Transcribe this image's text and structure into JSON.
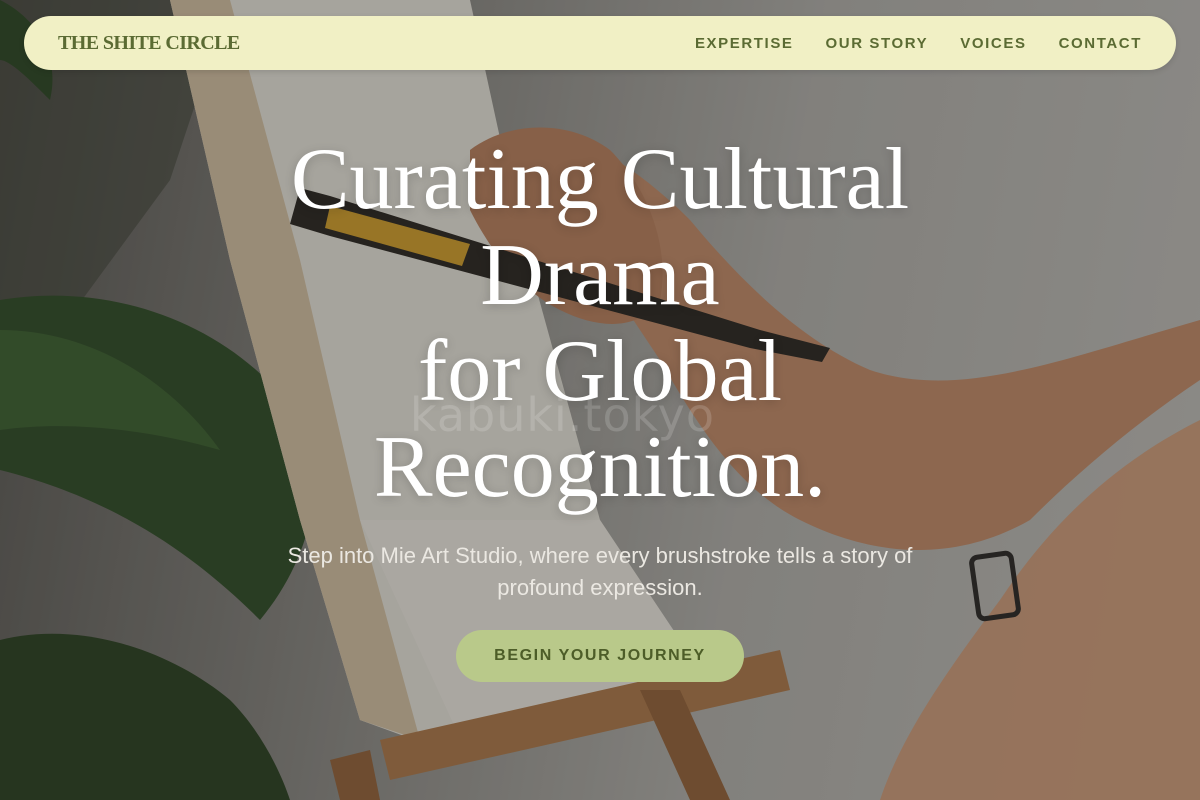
{
  "nav": {
    "brand": "THE SHITE CIRCLE",
    "links": [
      "EXPERTISE",
      "OUR STORY",
      "VOICES",
      "CONTACT"
    ]
  },
  "hero": {
    "title_lines": [
      "Curating Cultural",
      "Drama",
      "for Global",
      "Recognition."
    ],
    "subtitle": "Step into Mie Art Studio, where every brushstroke tells a story of profound expression.",
    "cta_label": "BEGIN YOUR JOURNEY"
  },
  "background": {
    "watermark": "kabuki.tokyo"
  },
  "colors": {
    "nav_bg": "#f1f0c5",
    "nav_text": "#5b6b33",
    "cta_bg": "#b9c98a",
    "cta_text": "#4d5d28",
    "title_text": "#ffffff"
  }
}
